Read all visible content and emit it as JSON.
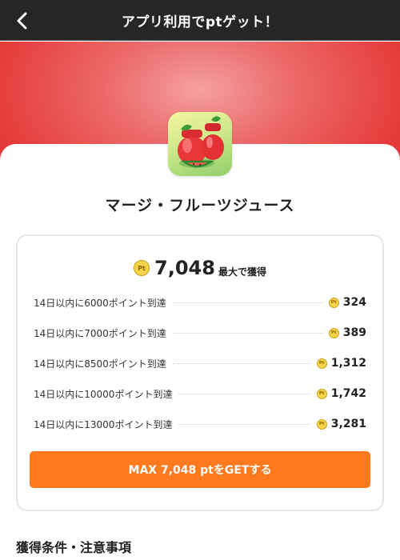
{
  "header": {
    "title": "アプリ利用でptゲット！",
    "back_icon": "chevron-left-icon"
  },
  "hero": {
    "colors": {
      "top": "#e53a3a",
      "center": "#f4a0a0"
    }
  },
  "app": {
    "name": "マージ・フルーツジュース",
    "icon": "fruit-juice-app-icon"
  },
  "reward": {
    "coin_label": "Pt",
    "total_value": "7,048",
    "total_suffix": "最大で獲得",
    "conditions": [
      {
        "label": "14日以内に6000ポイント到達",
        "points": "324"
      },
      {
        "label": "14日以内に7000ポイント到達",
        "points": "389"
      },
      {
        "label": "14日以内に8500ポイント到達",
        "points": "1,312"
      },
      {
        "label": "14日以内に10000ポイント到達",
        "points": "1,742"
      },
      {
        "label": "14日以内に13000ポイント到達",
        "points": "3,281"
      }
    ],
    "button_label": "MAX 7,048 ptをGETする",
    "button_color": "#ff7a1e"
  },
  "section": {
    "heading": "獲得条件・注意事項"
  }
}
